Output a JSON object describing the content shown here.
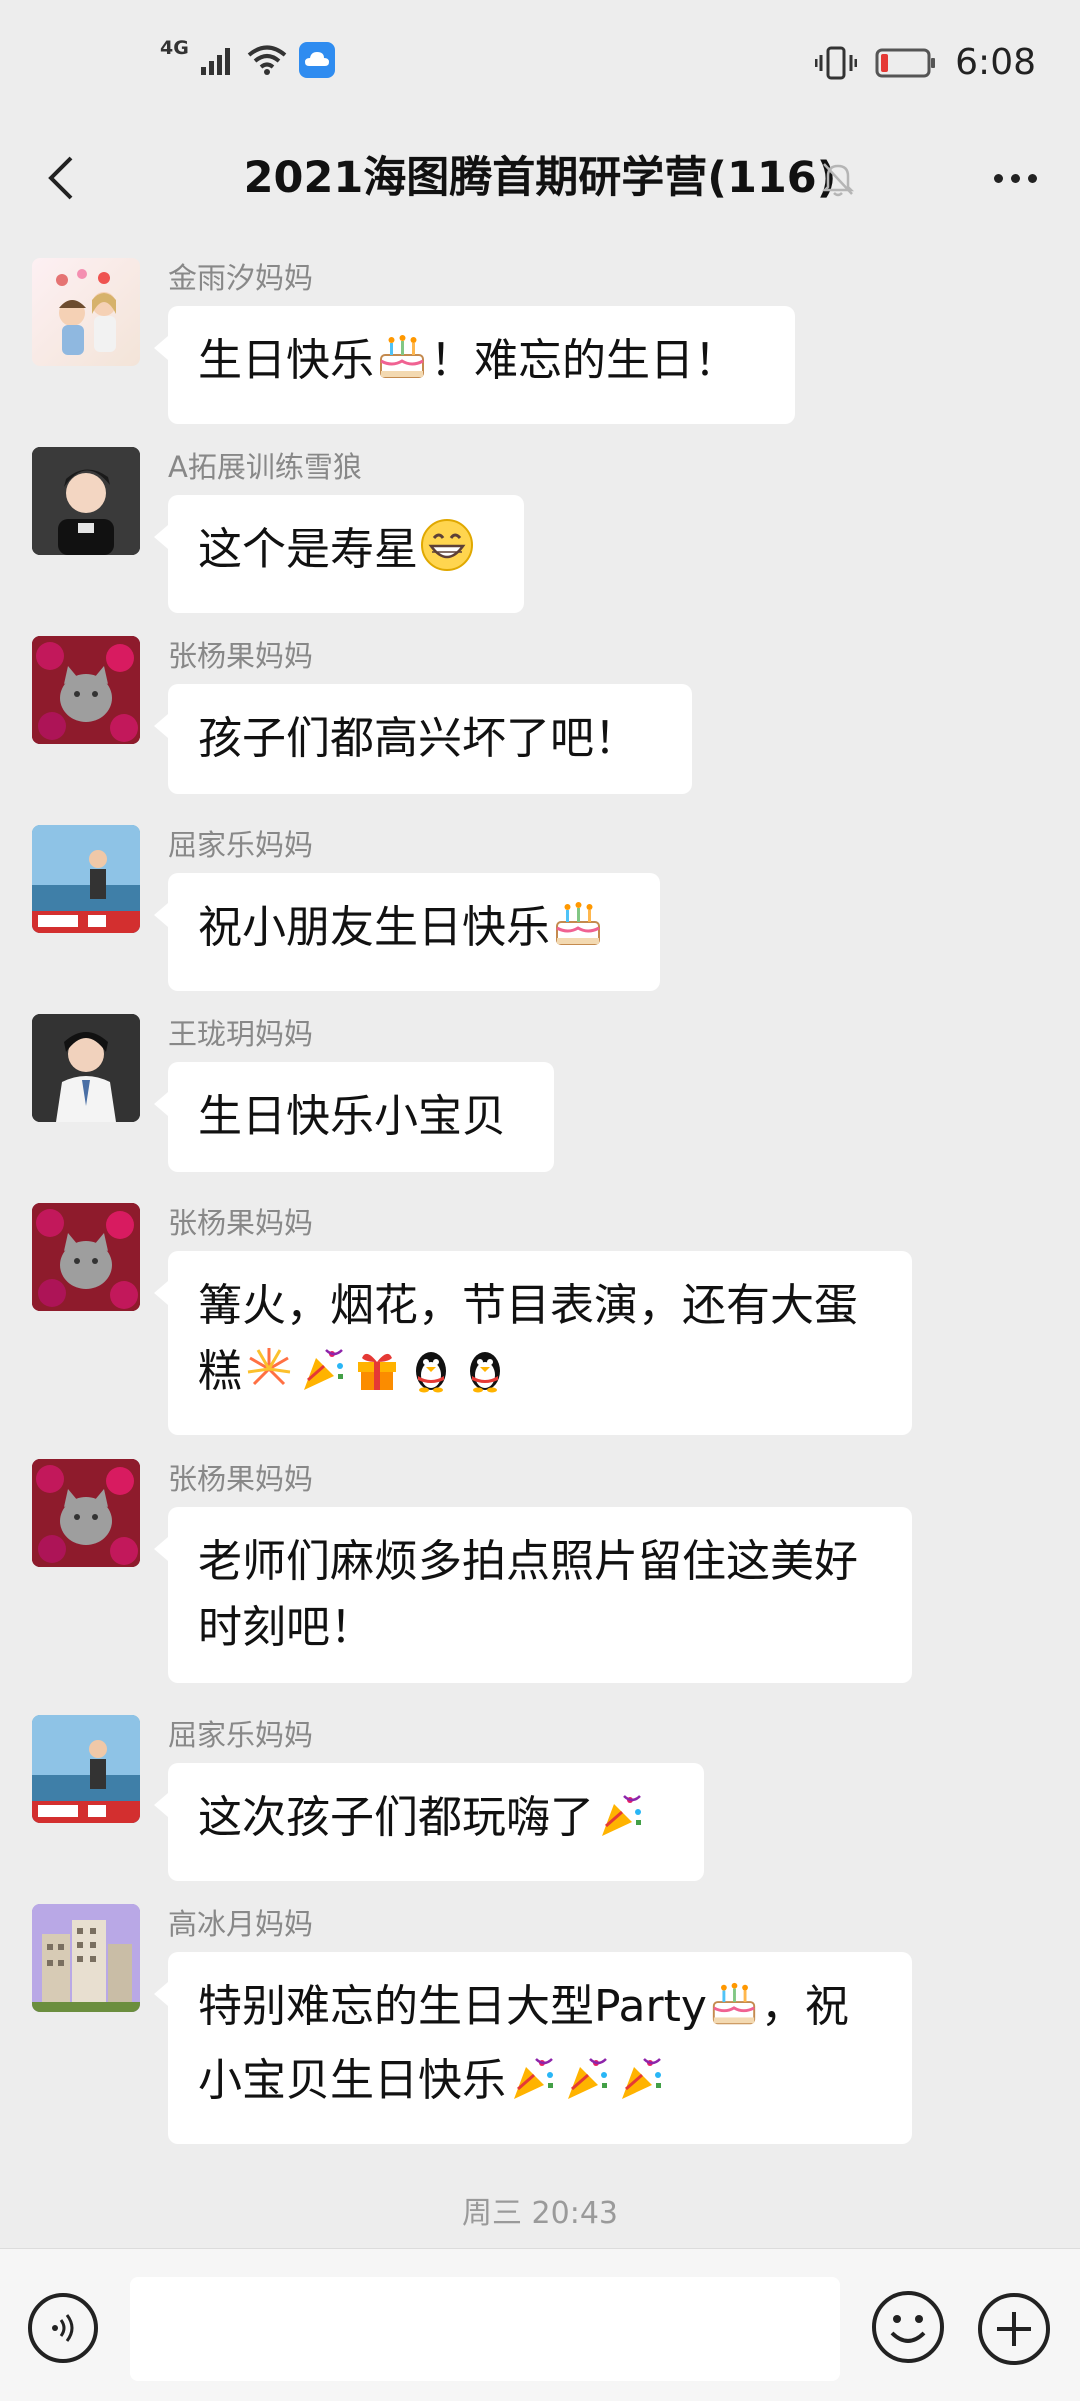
{
  "status_bar": {
    "network": "4G",
    "time": "6:08"
  },
  "header": {
    "title": "2021海图腾首期研学营(116)"
  },
  "messages": [
    {
      "sender": "金雨汐妈妈",
      "text": "生日快乐",
      "emojis_after_text": [
        "cake-emoji"
      ],
      "suffix": "！难忘的生日！",
      "avatar": "cartoon-couple-avatar"
    },
    {
      "sender": "A拓展训练雪狼",
      "text": "这个是寿星",
      "emojis_after_text": [
        "grin-emoji"
      ],
      "suffix": "",
      "avatar": "young-man-avatar"
    },
    {
      "sender": "张杨果妈妈",
      "text": "孩子们都高兴坏了吧！",
      "emojis_after_text": [],
      "suffix": "",
      "avatar": "cat-flowers-avatar"
    },
    {
      "sender": "屈家乐妈妈",
      "text": "祝小朋友生日快乐",
      "emojis_after_text": [
        "cake-emoji"
      ],
      "suffix": "",
      "avatar": "seaside-boy-avatar"
    },
    {
      "sender": "王珑玥妈妈",
      "text": "生日快乐小宝贝",
      "emojis_after_text": [],
      "suffix": "",
      "avatar": "woman-white-jacket-avatar"
    },
    {
      "sender": "张杨果妈妈",
      "text": "篝火，烟花，节目表演，还有大蛋糕",
      "emojis_after_text": [
        "fireworks-emoji",
        "party-popper-emoji",
        "gift-emoji",
        "penguin-emoji",
        "penguin-emoji"
      ],
      "suffix": "",
      "avatar": "cat-flowers-avatar"
    },
    {
      "sender": "张杨果妈妈",
      "text": "老师们麻烦多拍点照片留住这美好时刻吧！",
      "emojis_after_text": [],
      "suffix": "",
      "avatar": "cat-flowers-avatar"
    },
    {
      "sender": "屈家乐妈妈",
      "text": "这次孩子们都玩嗨了",
      "emojis_after_text": [
        "party-popper-emoji"
      ],
      "suffix": "",
      "avatar": "seaside-boy-avatar"
    },
    {
      "sender": "高冰月妈妈",
      "text": "特别难忘的生日大型Party",
      "emojis_after_text": [
        "cake-emoji"
      ],
      "suffix": "，祝小宝贝生日快乐",
      "suffix_emojis": [
        "party-popper-emoji",
        "party-popper-emoji",
        "party-popper-emoji"
      ],
      "avatar": "building-avatar"
    }
  ],
  "timestamp": "周三 20:43",
  "input_bar": {
    "placeholder": ""
  },
  "colors": {
    "background": "#ededed",
    "bubble": "#ffffff",
    "battery_low": "#e53935"
  }
}
